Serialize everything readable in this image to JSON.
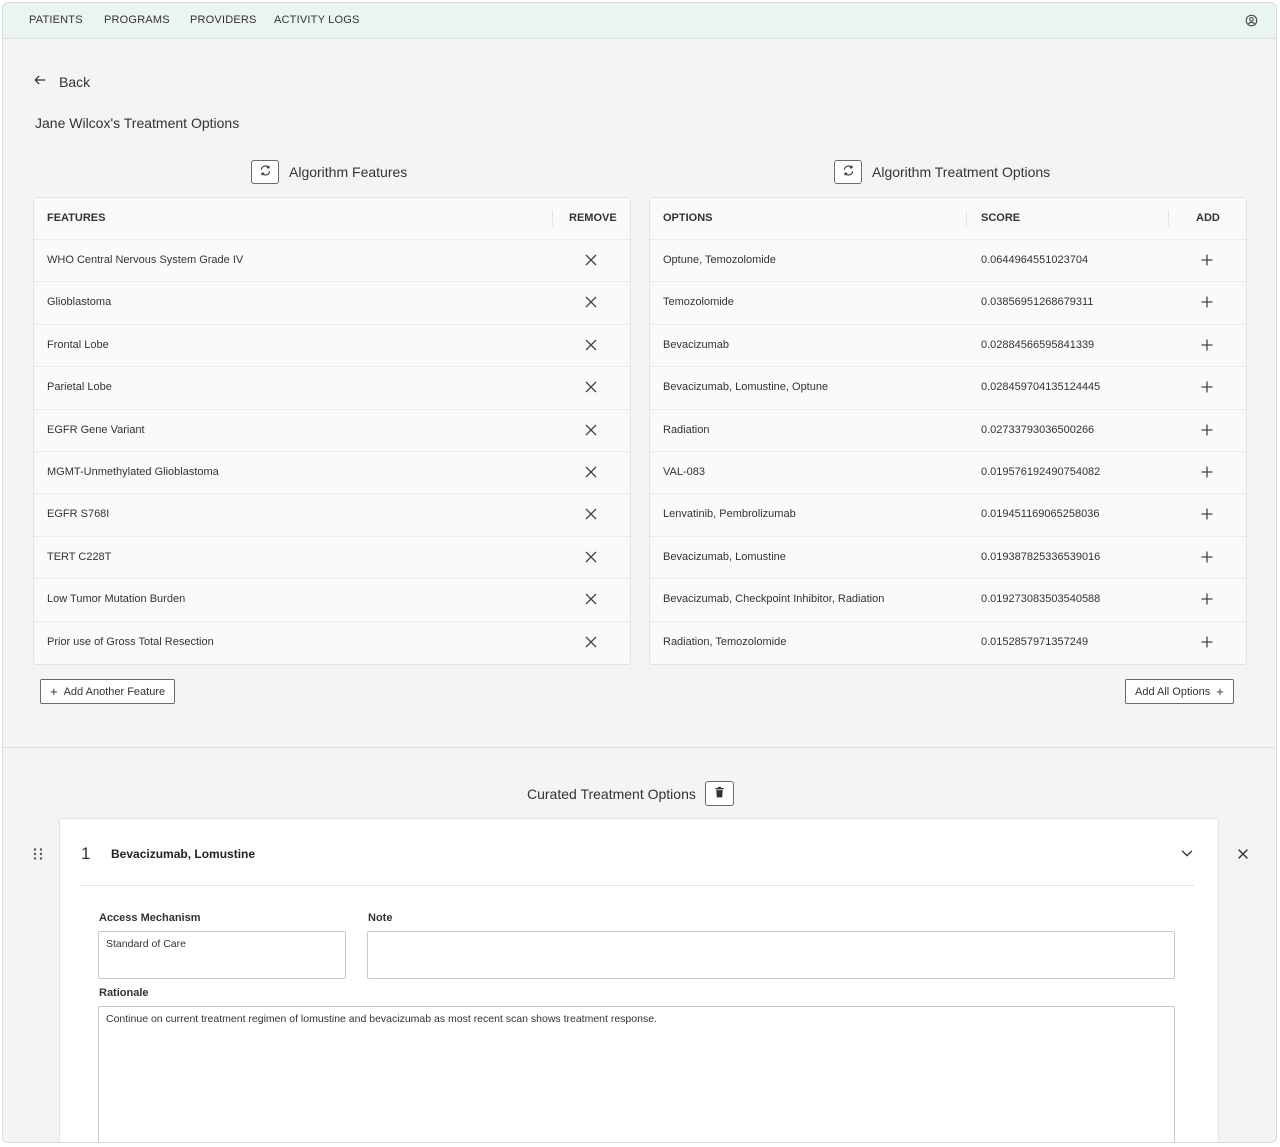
{
  "nav": {
    "items": [
      "PATIENTS",
      "PROGRAMS",
      "PROVIDERS",
      "ACTIVITY LOGS"
    ]
  },
  "back_label": "Back",
  "page_title": "Jane Wilcox's Treatment Options",
  "features_panel": {
    "title": "Algorithm Features",
    "col_features": "FEATURES",
    "col_remove": "REMOVE",
    "rows": [
      "WHO Central Nervous System Grade IV",
      "Glioblastoma",
      "Frontal Lobe",
      "Parietal Lobe",
      "EGFR Gene Variant",
      "MGMT-Unmethylated Glioblastoma",
      "EGFR S768I",
      "TERT C228T",
      "Low Tumor Mutation Burden",
      "Prior use of Gross Total Resection"
    ],
    "add_button": "Add Another Feature"
  },
  "options_panel": {
    "title": "Algorithm Treatment Options",
    "col_options": "OPTIONS",
    "col_score": "SCORE",
    "col_add": "ADD",
    "rows": [
      {
        "option": "Optune, Temozolomide",
        "score": "0.0644964551023704"
      },
      {
        "option": "Temozolomide",
        "score": "0.03856951268679311"
      },
      {
        "option": "Bevacizumab",
        "score": "0.02884566595841339"
      },
      {
        "option": "Bevacizumab, Lomustine, Optune",
        "score": "0.028459704135124445"
      },
      {
        "option": "Radiation",
        "score": "0.02733793036500266"
      },
      {
        "option": "VAL-083",
        "score": "0.019576192490754082"
      },
      {
        "option": "Lenvatinib, Pembrolizumab",
        "score": "0.019451169065258036"
      },
      {
        "option": "Bevacizumab, Lomustine",
        "score": "0.019387825336539016"
      },
      {
        "option": "Bevacizumab, Checkpoint Inhibitor, Radiation",
        "score": "0.019273083503540588"
      },
      {
        "option": "Radiation, Temozolomide",
        "score": "0.0152857971357249"
      }
    ],
    "add_all_button": "Add All Options"
  },
  "curated": {
    "title": "Curated Treatment Options",
    "card": {
      "number": "1",
      "title": "Bevacizumab, Lomustine",
      "access_label": "Access Mechanism",
      "access_value": "Standard of Care",
      "note_label": "Note",
      "note_value": "",
      "rationale_label": "Rationale",
      "rationale_value": "Continue on current treatment regimen of lomustine and bevacizumab as most recent scan shows treatment response."
    }
  },
  "icons": {
    "user": "user-circle-icon",
    "back": "arrow-left-icon",
    "refresh": "refresh-icon",
    "remove": "close-icon",
    "add": "plus-icon",
    "trash": "trash-icon",
    "drag": "drag-handle-icon",
    "expand": "chevron-down-icon"
  }
}
